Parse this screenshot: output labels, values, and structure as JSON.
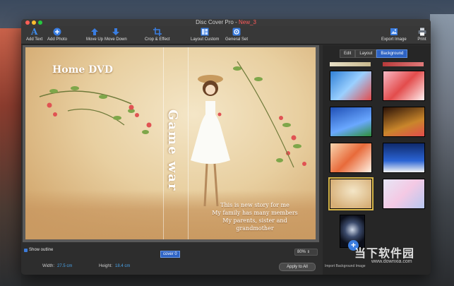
{
  "window": {
    "title": "Disc Cover Pro - ",
    "title_doc": "New_3"
  },
  "toolbar": {
    "add_text": "Add Text",
    "add_photo": "Add Photo",
    "move_up": "Move Up",
    "move_down": "Move Down",
    "crop_effect": "Crop & Effect",
    "layout_custom": "Layout Custom",
    "general_set": "General Set",
    "export_image": "Export Image",
    "print": "Print"
  },
  "cover": {
    "title": "Home DVD",
    "spine_title": "Game war",
    "story": [
      "This is new story for me",
      "My family has many members",
      "My parents, sister and",
      "grandmother"
    ]
  },
  "bottom": {
    "show_outline": "Show outline",
    "cover_label": "cover 0",
    "zoom": "80%",
    "width_label": "Width:",
    "width_value": "27.5 cm",
    "height_label": "Height:",
    "height_value": "18.4 cm",
    "apply_all": "Apply to All"
  },
  "panel": {
    "tabs": [
      "Edit",
      "Layout",
      "Background"
    ],
    "active_tab": "Background",
    "import_text": "Import Background Image"
  },
  "watermark": {
    "name": "当下软件园",
    "url": "www.downxia.com"
  },
  "colors": {
    "accent": "#2e63c4",
    "selected_border": "#d9b74a",
    "value_blue": "#4aa3e8",
    "title_new": "#ff5a5a"
  }
}
